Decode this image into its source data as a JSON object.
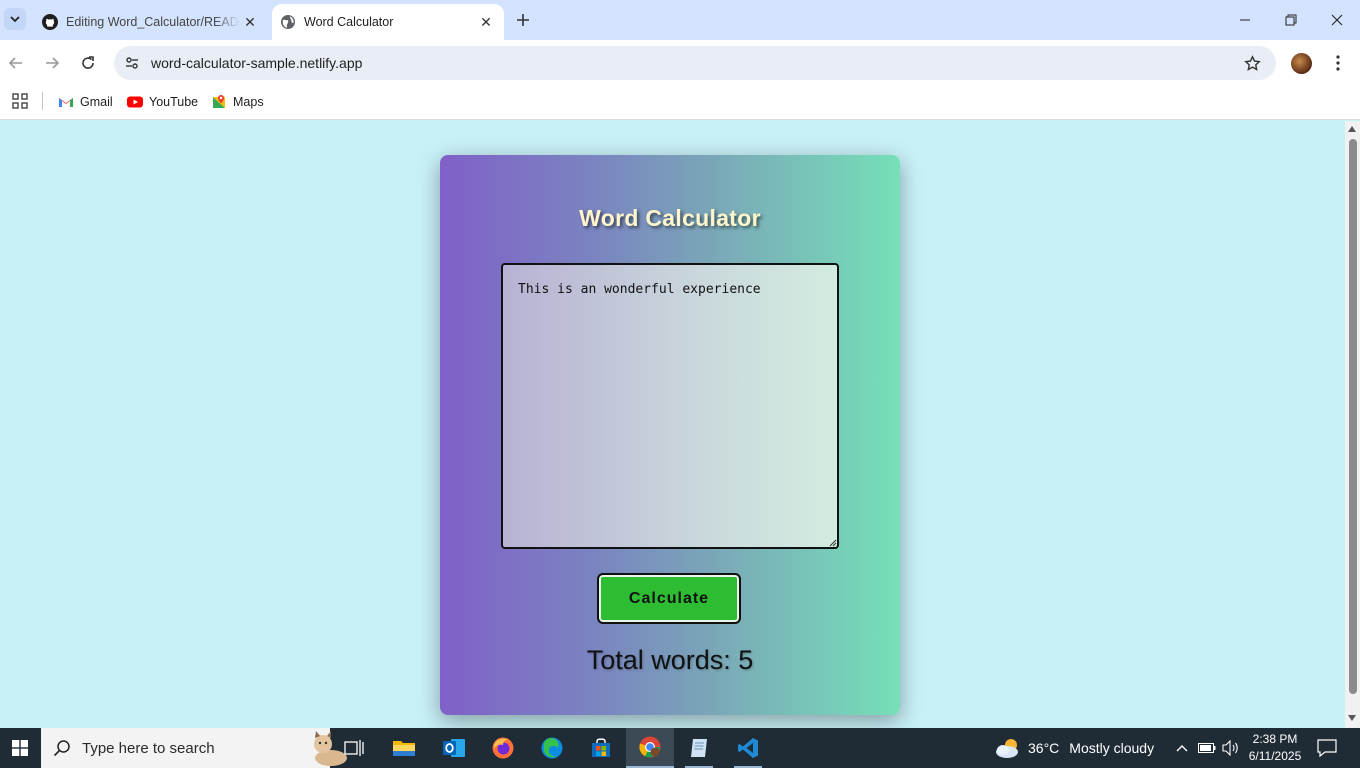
{
  "browser": {
    "tabs": [
      {
        "title": "Editing Word_Calculator/README.md",
        "active": false
      },
      {
        "title": "Word Calculator",
        "active": true
      }
    ],
    "url": "word-calculator-sample.netlify.app",
    "bookmarks": [
      {
        "label": "Gmail",
        "icon": "gmail-icon"
      },
      {
        "label": "YouTube",
        "icon": "youtube-icon"
      },
      {
        "label": "Maps",
        "icon": "maps-icon"
      }
    ]
  },
  "app": {
    "title": "Word Calculator",
    "input_text": "This is an wonderful experience",
    "button_label": "Calculate",
    "result": "Total words: 5",
    "colors": {
      "page_bg": "#c8f0f7",
      "card_gradient_start": "#8060c8",
      "card_gradient_end": "#76e0b8",
      "button": "#2ebd32",
      "title": "#fff6cc"
    }
  },
  "taskbar": {
    "search_placeholder": "Type here to search",
    "weather": {
      "temp": "36°C",
      "condition": "Mostly cloudy"
    },
    "time": "2:38 PM",
    "date": "6/11/2025"
  }
}
